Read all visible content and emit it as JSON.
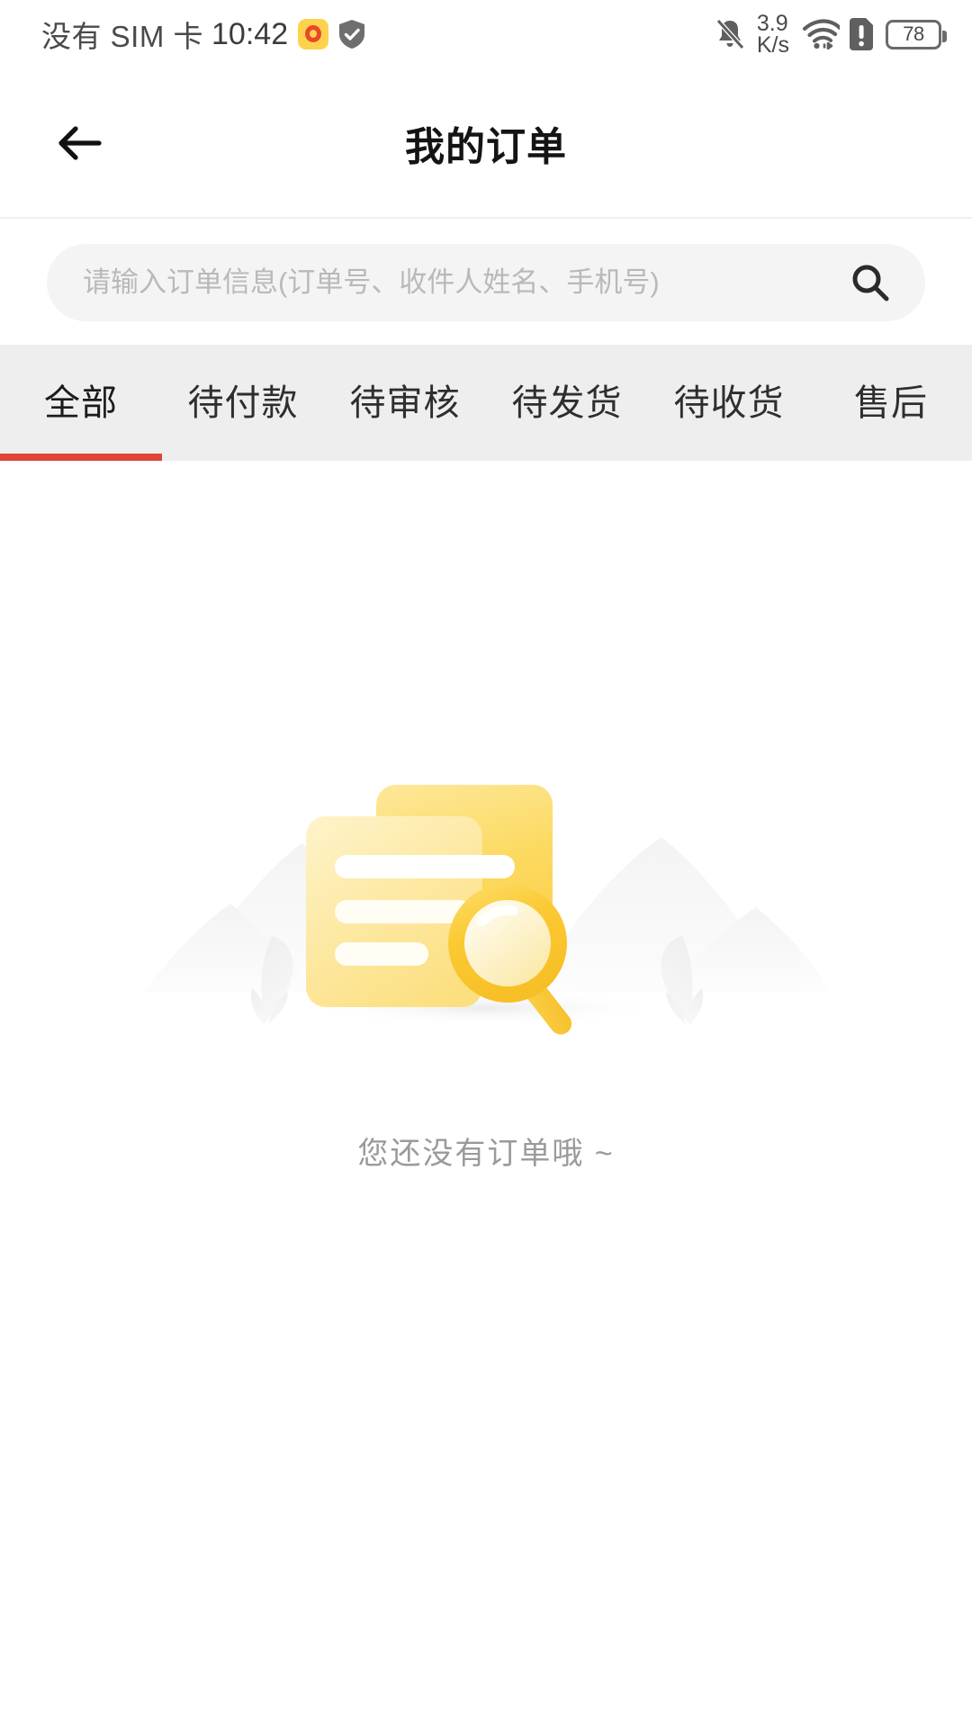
{
  "status_bar": {
    "carrier": "没有 SIM 卡",
    "time": "10:42",
    "network_speed_value": "3.9",
    "network_speed_unit": "K/s",
    "battery_level": "78",
    "icons": {
      "weibo": "weibo-icon",
      "shield": "shield-icon",
      "bell_muted": "bell-muted-icon",
      "wifi": "wifi-icon",
      "sim_alert": "sim-alert-icon",
      "battery": "battery-icon"
    }
  },
  "nav": {
    "title": "我的订单",
    "back_icon": "arrow-left-icon"
  },
  "search": {
    "placeholder": "请输入订单信息(订单号、收件人姓名、手机号)",
    "value": "",
    "icon": "search-icon"
  },
  "tabs": {
    "active_index": 0,
    "items": [
      {
        "label": "全部"
      },
      {
        "label": "待付款"
      },
      {
        "label": "待审核"
      },
      {
        "label": "待发货"
      },
      {
        "label": "待收货"
      },
      {
        "label": "售后"
      }
    ]
  },
  "empty_state": {
    "message": "您还没有订单哦 ~",
    "illustration": "empty-order-document-magnifier"
  },
  "colors": {
    "accent_red": "#e04337",
    "tab_bar_bg": "#eeeeee",
    "search_bg": "#f4f4f4",
    "illustration_yellow": "#fcd34a",
    "empty_text": "#9a9a9a"
  }
}
